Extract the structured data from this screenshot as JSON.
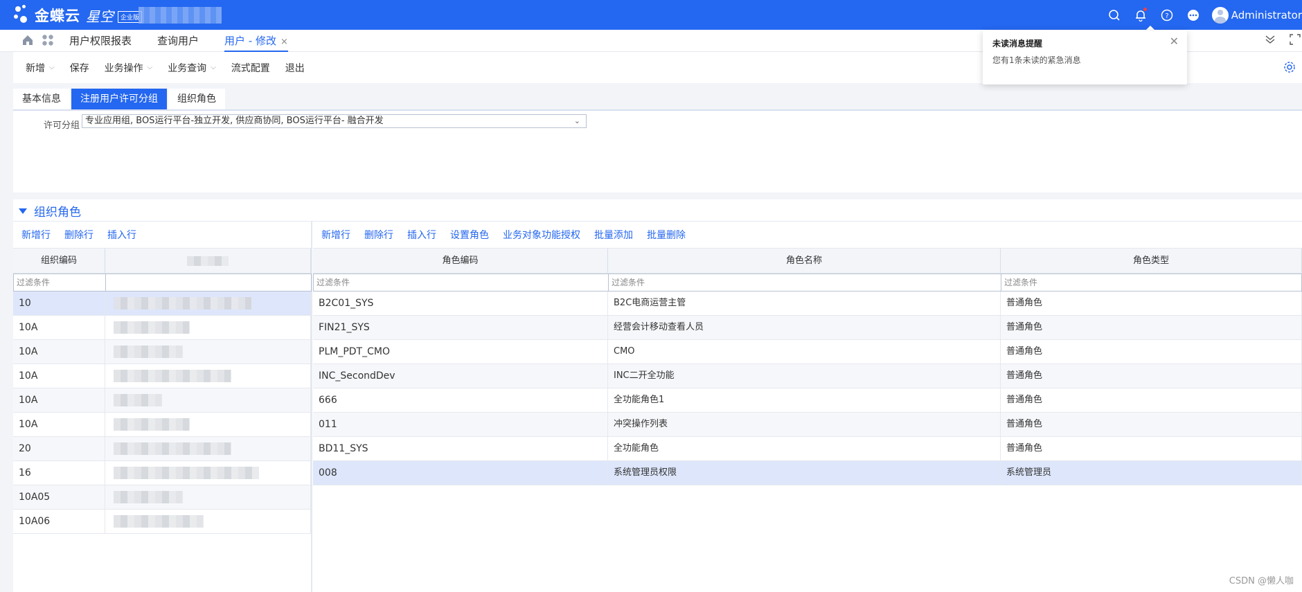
{
  "app": {
    "logo_text": "金蝶云",
    "logo_text2": "星空",
    "logo_badge": "企业版",
    "user": "Administrator"
  },
  "tabs": [
    {
      "label": "用户权限报表"
    },
    {
      "label": "查询用户"
    },
    {
      "label": "用户 - 修改",
      "close": "×"
    }
  ],
  "toolbar": {
    "new": "新增",
    "save": "保存",
    "biz_op": "业务操作",
    "biz_query": "业务查询",
    "flow": "流式配置",
    "exit": "退出"
  },
  "info_tabs": [
    "基本信息",
    "注册用户许可分组",
    "组织角色"
  ],
  "form": {
    "label": "许可分组",
    "value": "专业应用组, BOS运行平台-独立开发, 供应商协同, BOS运行平台- 融合开发"
  },
  "section": {
    "title": "组织角色"
  },
  "left_grid": {
    "buttons": [
      "新增行",
      "删除行",
      "插入行"
    ],
    "headers": [
      "组织编码",
      ""
    ],
    "filter_placeholder": "过滤条件",
    "rows": [
      "10",
      "10A",
      "10A",
      "10A",
      "10A",
      "10A",
      "20",
      "16",
      "10A05",
      "10A06"
    ]
  },
  "right_grid": {
    "buttons": [
      "新增行",
      "删除行",
      "插入行",
      "设置角色",
      "业务对象功能授权",
      "批量添加",
      "批量删除"
    ],
    "headers": [
      "角色编码",
      "角色名称",
      "角色类型"
    ],
    "filter_placeholder": "过滤条件",
    "rows": [
      [
        "B2C01_SYS",
        "B2C电商运营主管",
        "普通角色"
      ],
      [
        "FIN21_SYS",
        "经营会计移动查看人员",
        "普通角色"
      ],
      [
        "PLM_PDT_CMO",
        "CMO",
        "普通角色"
      ],
      [
        "INC_SecondDev",
        "INC二开全功能",
        "普通角色"
      ],
      [
        "666",
        "全功能角色1",
        "普通角色"
      ],
      [
        "011",
        "冲突操作列表",
        "普通角色"
      ],
      [
        "BD11_SYS",
        "全功能角色",
        "普通角色"
      ],
      [
        "008",
        "系统管理员权限",
        "系统管理员"
      ]
    ]
  },
  "notification": {
    "title": "未读消息提醒",
    "message": "您有1条未读的紧急消息"
  },
  "watermark": "CSDN @懒人咖"
}
